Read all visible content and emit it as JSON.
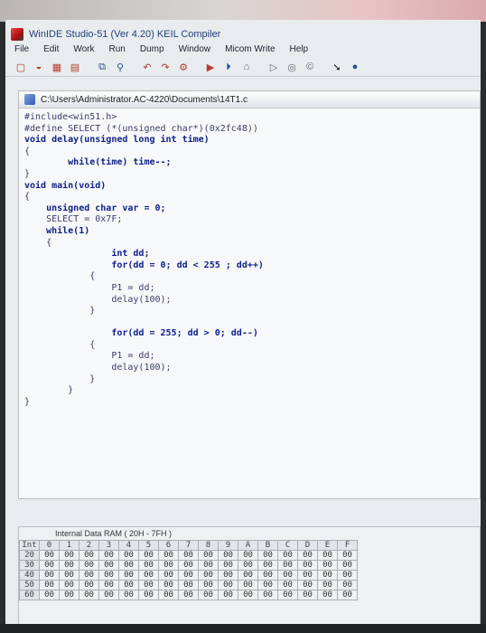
{
  "window": {
    "title": "WinIDE Studio-51 (Ver 4.20) KEIL Compiler"
  },
  "menu": [
    "File",
    "Edit",
    "Work",
    "Run",
    "Dump",
    "Window",
    "Micom Write",
    "Help"
  ],
  "toolbar": {
    "icons": [
      "new-file-icon",
      "open-folder-icon",
      "save-icon",
      "print-icon",
      "copy-icon",
      "paste-icon",
      "find-icon",
      "replace-icon",
      "undo-icon",
      "redo-icon",
      "build-icon",
      "run-icon",
      "step-icon",
      "download-icon",
      "stop-icon",
      "reset-icon",
      "arrow-icon",
      "record-icon"
    ]
  },
  "editor": {
    "path": "C:\\Users\\Administrator.AC-4220\\Documents\\14T1.c",
    "lines": [
      "#include<win51.h>",
      "#define SELECT (*(unsigned char*)(0x2fc48))",
      "void delay(unsigned long int time)",
      "{",
      "        while(time) time--;",
      "}",
      "void main(void)",
      "{",
      "    unsigned char var = 0;",
      "    SELECT = 0x7F;",
      "    while(1)",
      "    {",
      "                int dd;",
      "                for(dd = 0; dd < 255 ; dd++)",
      "            {",
      "                P1 = dd;",
      "                delay(100);",
      "            }",
      "",
      "                for(dd = 255; dd > 0; dd--)",
      "            {",
      "                P1 = dd;",
      "                delay(100);",
      "            }",
      "        }",
      "}"
    ]
  },
  "ram": {
    "title": "Internal Data RAM ( 20H - 7FH )",
    "corner": "Int",
    "columns": [
      "0",
      "1",
      "2",
      "3",
      "4",
      "5",
      "6",
      "7",
      "8",
      "9",
      "A",
      "B",
      "C",
      "D",
      "E",
      "F"
    ],
    "rows": [
      {
        "addr": "20",
        "cells": [
          "00",
          "00",
          "00",
          "00",
          "00",
          "00",
          "00",
          "00",
          "00",
          "00",
          "00",
          "00",
          "00",
          "00",
          "00",
          "00"
        ]
      },
      {
        "addr": "30",
        "cells": [
          "00",
          "00",
          "00",
          "00",
          "00",
          "00",
          "00",
          "00",
          "00",
          "00",
          "00",
          "00",
          "00",
          "00",
          "00",
          "00"
        ]
      },
      {
        "addr": "40",
        "cells": [
          "00",
          "00",
          "00",
          "00",
          "00",
          "00",
          "00",
          "00",
          "00",
          "00",
          "00",
          "00",
          "00",
          "00",
          "00",
          "00"
        ]
      },
      {
        "addr": "50",
        "cells": [
          "00",
          "00",
          "00",
          "00",
          "00",
          "00",
          "00",
          "00",
          "00",
          "00",
          "00",
          "00",
          "00",
          "00",
          "00",
          "00"
        ]
      },
      {
        "addr": "60",
        "cells": [
          "00",
          "00",
          "00",
          "00",
          "00",
          "00",
          "00",
          "00",
          "00",
          "00",
          "00",
          "00",
          "00",
          "00",
          "00",
          "00"
        ]
      }
    ]
  }
}
